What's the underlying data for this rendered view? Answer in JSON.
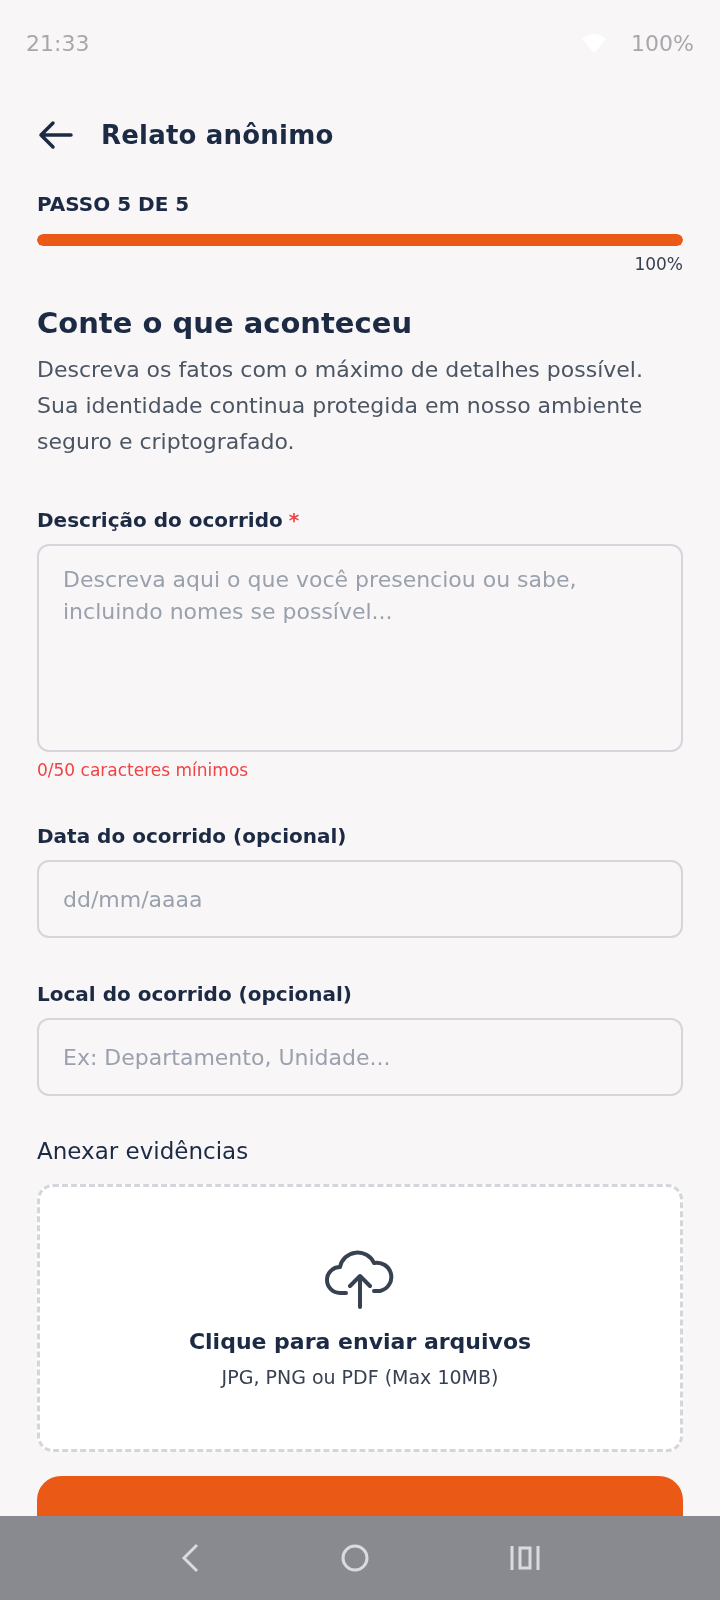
{
  "status_bar": {
    "time": "21:33",
    "battery": "100%"
  },
  "header": {
    "title": "Relato anônimo"
  },
  "progress": {
    "step": "PASSO 5 DE 5",
    "level": 1,
    "reading": "100%"
  },
  "section": {
    "title": "Conte o que aconteceu",
    "description": "Descreva os fatos com o máximo de detalhes possível. Sua identidade continua protegida em nosso ambiente seguro e criptografado."
  },
  "fields": [
    {
      "kind": "textarea",
      "label": "Descrição do ocorrido",
      "required": true,
      "placeholder": "Descreva aqui o que você presenciou ou sabe, incluindo nomes se possível...",
      "hint": "0/50 caracteres mínimos"
    },
    {
      "kind": "input",
      "label": "Data do ocorrido (opcional)",
      "required": false,
      "placeholder": "dd/mm/aaaa"
    },
    {
      "kind": "input",
      "label": "Local do ocorrido (opcional)",
      "required": false,
      "placeholder": "Ex: Departamento, Unidade..."
    }
  ],
  "attachments": {
    "title": "Anexar evidências",
    "prompt": "Clique para enviar arquivos",
    "formats": "JPG, PNG ou PDF (Max 10MB)"
  },
  "required_mark": "*"
}
